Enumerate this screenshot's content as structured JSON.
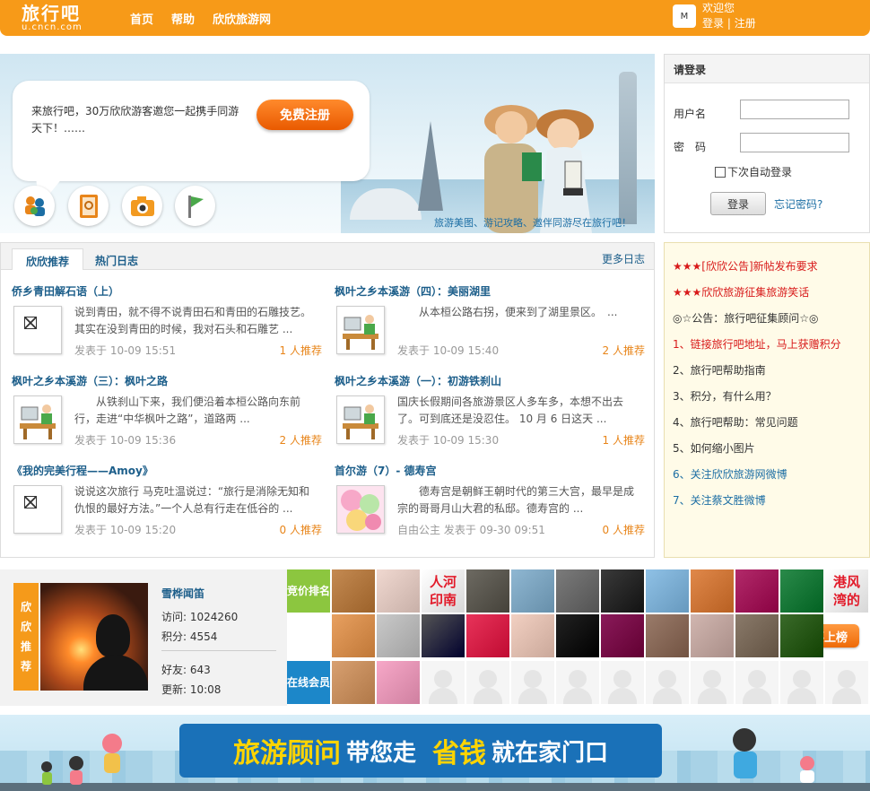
{
  "header": {
    "logo_cn": "旅行吧",
    "logo_url": "u.cncn.com",
    "nav": [
      "首页",
      "帮助",
      "欣欣旅游网"
    ],
    "avatar_text": "M",
    "welcome": "欢迎您",
    "login": "登录",
    "sep": "|",
    "register": "注册"
  },
  "banner": {
    "invite": "来旅行吧，30万欣欣游客邀您一起携手同游天下！……",
    "register_button": "免费注册",
    "caption": "旅游美图、游记攻略、邀伴同游尽在旅行吧！",
    "icons": [
      "users-icon",
      "address-book-icon",
      "camera-icon",
      "flag-icon"
    ]
  },
  "login": {
    "title": "请登录",
    "username_label": "用户名",
    "password_label": "密　码",
    "remember": "下次自动登录",
    "submit": "登录",
    "forgot": "忘记密码?"
  },
  "posts": {
    "tabs": [
      "欣欣推荐",
      "热门日志"
    ],
    "more": "更多日志",
    "items": [
      {
        "title": "侨乡青田解石语（上）",
        "body": "说到青田，就不得不说青田石和青田的石雕技艺。其实在没到青田的时候，我对石头和石雕艺 ...",
        "meta": "发表于 10-09 15:51",
        "rec": "1 人推荐",
        "thumb": "broken"
      },
      {
        "title": "枫叶之乡本溪游（四）：美丽湖里",
        "body": "　　从本桓公路右拐，便来到了湖里景区。　...",
        "meta": "发表于 10-09 15:40",
        "rec": "2 人推荐",
        "thumb": "writer"
      },
      {
        "title": "枫叶之乡本溪游（三）：枫叶之路",
        "body": "　　从铁刹山下来，我们便沿着本桓公路向东前行，走进“中华枫叶之路”，道路两 ...",
        "meta": "发表于 10-09 15:36",
        "rec": "2 人推荐",
        "thumb": "writer"
      },
      {
        "title": "枫叶之乡本溪游（一）：初游铁刹山",
        "body": "国庆长假期间各旅游景区人多车多，本想不出去了。可到底还是没忍住。 10 月 6 日这天 ...",
        "meta": "发表于 10-09 15:30",
        "rec": "1 人推荐",
        "thumb": "writer"
      },
      {
        "title": "《我的完美行程——Amoy》",
        "body": "说说这次旅行 马克吐温说过：“旅行是消除无知和仇恨的最好方法。”一个人总有行走在低谷的 ...",
        "meta": "发表于 10-09 15:20",
        "rec": "0 人推荐",
        "thumb": "broken"
      },
      {
        "title": "首尔游（7）- 德寿宫",
        "body": "　　德寿宫是朝鲜王朝时代的第三大宫，最早是成宗的哥哥月山大君的私邸。德寿宫的 ...",
        "meta": "自由公主 发表于 09-30 09:51",
        "rec": "0 人推荐",
        "thumb": "candy"
      }
    ]
  },
  "notices": [
    {
      "text": "★★★[欣欣公告]新帖发布要求",
      "color": "#d81a1a"
    },
    {
      "text": "★★★欣欣旅游征集旅游笑话",
      "color": "#d81a1a"
    },
    {
      "text": "◎☆公告：旅行吧征集顾问☆◎",
      "color": "#333333"
    },
    {
      "text": "1、链接旅行吧地址，马上获赠积分",
      "color": "#d81a1a"
    },
    {
      "text": "2、旅行吧帮助指南",
      "color": "#333333"
    },
    {
      "text": "3、积分，有什么用？",
      "color": "#333333"
    },
    {
      "text": "4、旅行吧帮助：常见问题",
      "color": "#333333"
    },
    {
      "text": "5、如何缩小图片",
      "color": "#333333"
    },
    {
      "text": "6、关注欣欣旅游网微博",
      "color": "#1c6ea4"
    },
    {
      "text": "7、关注蔡文胜微博",
      "color": "#1c6ea4"
    }
  ],
  "member": {
    "tag": [
      "欣",
      "欣",
      "推",
      "荐"
    ],
    "name": "雪桦闻笛",
    "visits": "访问: 1024260",
    "points": "积分: 4554",
    "friends": "好友: 643",
    "updated": "更新: 10:08"
  },
  "rank": {
    "bid_label": "竞价排名",
    "online_label": "在线会员",
    "button": "我要上榜",
    "tile_texts": [
      "人河",
      "印南",
      "港风",
      "湾的"
    ]
  },
  "ad": {
    "p1": "旅游顾问",
    "p2": "带您走",
    "p3": "省钱",
    "p4": "就在家门口"
  }
}
